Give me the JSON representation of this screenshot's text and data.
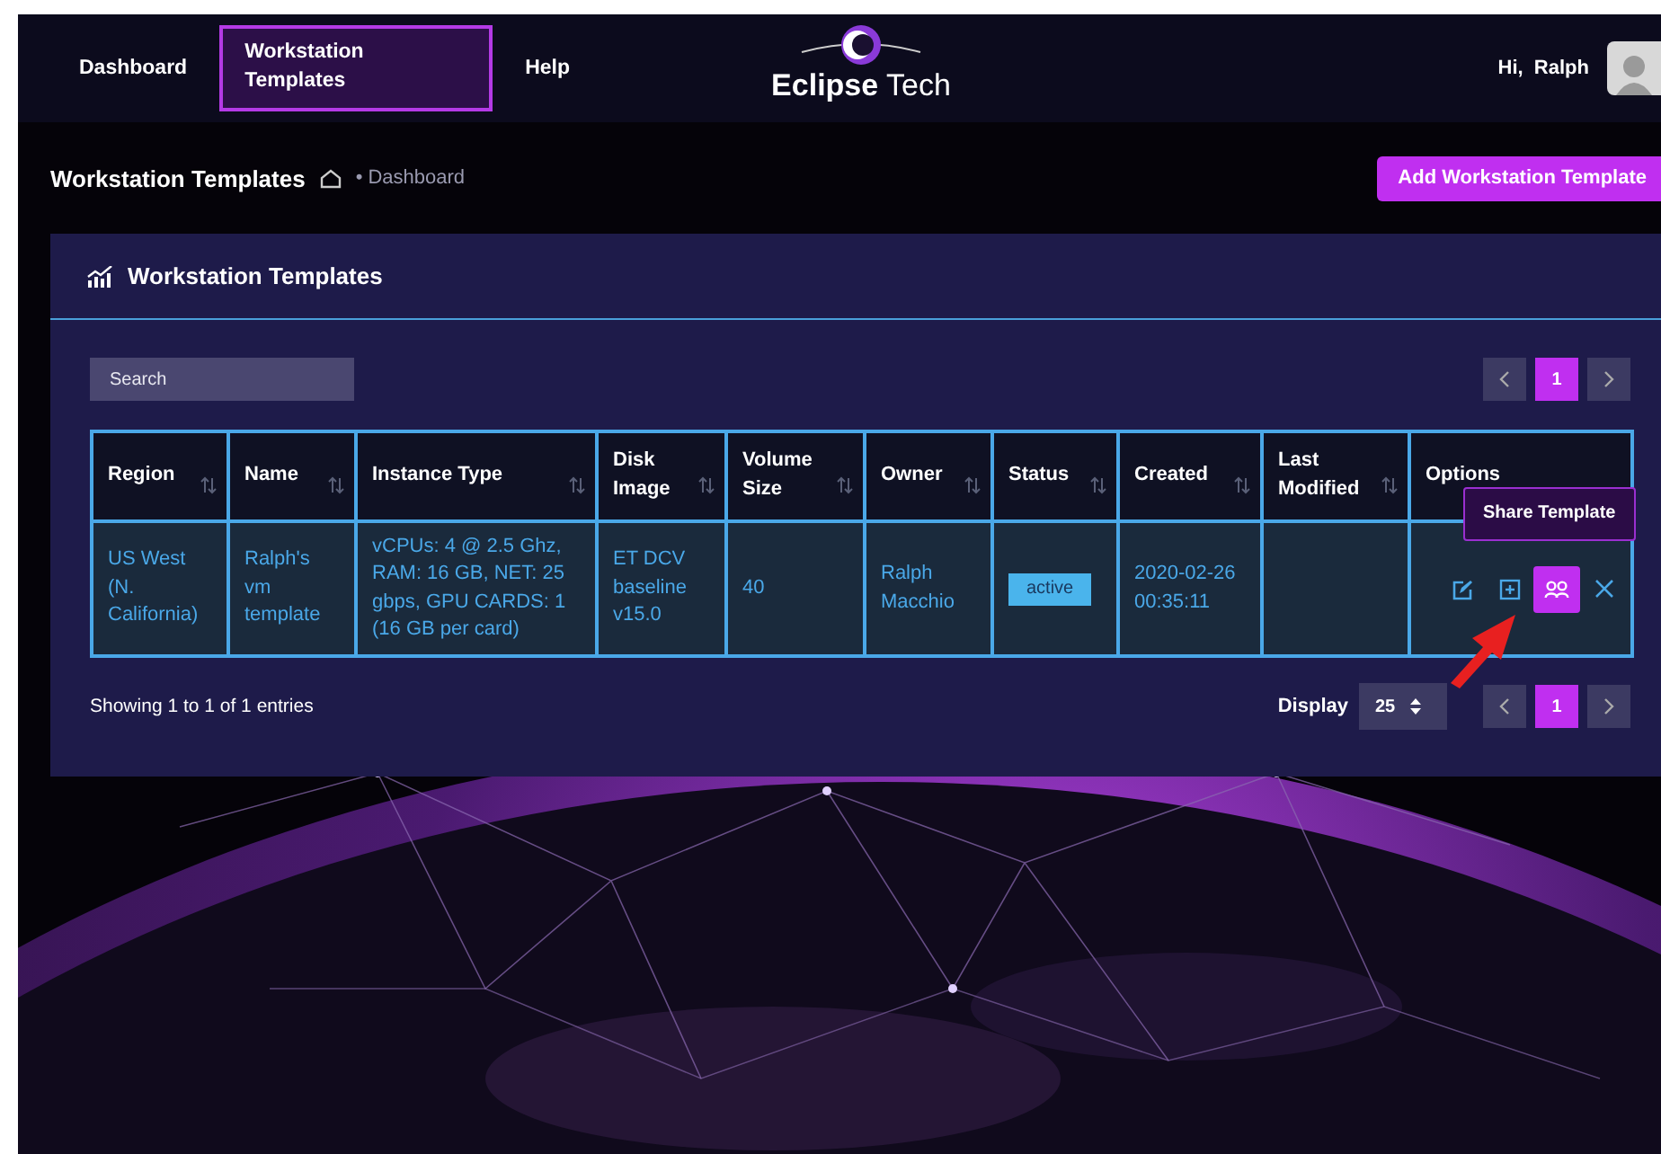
{
  "nav": {
    "items": [
      {
        "label": "Dashboard",
        "selected": false
      },
      {
        "label": "Workstation Templates",
        "selected": true
      },
      {
        "label": "Help",
        "selected": false
      }
    ],
    "logo": {
      "strong": "Eclipse",
      "light": "Tech"
    },
    "greeting": "Hi,  Ralph"
  },
  "header": {
    "title": "Workstation Templates",
    "breadcrumb": "• Dashboard",
    "add_button": "Add Workstation Template"
  },
  "panel": {
    "title": "Workstation Templates",
    "search": {
      "placeholder": "Search"
    },
    "pagination_top": {
      "pages": [
        {
          "label": "1",
          "selected": true
        }
      ]
    },
    "table": {
      "columns": [
        {
          "label": "Region",
          "sortable": true
        },
        {
          "label": "Name",
          "sortable": true
        },
        {
          "label": "Instance Type",
          "sortable": true
        },
        {
          "label": "Disk Image",
          "sortable": true
        },
        {
          "label": "Volume Size",
          "sortable": true
        },
        {
          "label": "Owner",
          "sortable": true
        },
        {
          "label": "Status",
          "sortable": true
        },
        {
          "label": "Created",
          "sortable": true
        },
        {
          "label": "Last Modified",
          "sortable": true
        },
        {
          "label": "Options",
          "sortable": false
        }
      ],
      "rows": [
        {
          "region": "US West (N. California)",
          "name": "Ralph's vm template",
          "instance_type": "vCPUs: 4 @ 2.5 Ghz, RAM: 16 GB, NET: 25 gbps, GPU CARDS: 1 (16 GB per card)",
          "disk_image": "ET DCV baseline v15.0",
          "volume_size": "40",
          "owner": "Ralph Macchio",
          "status": "active",
          "created": "2020-02-26 00:35:11",
          "options": [
            {
              "kind": "edit",
              "highlighted": false
            },
            {
              "kind": "add",
              "highlighted": false
            },
            {
              "kind": "share",
              "highlighted": true,
              "tooltip": "Share Template"
            },
            {
              "kind": "delete",
              "highlighted": false
            }
          ]
        }
      ]
    },
    "footer": {
      "summary": "Showing 1 to 1 of 1 entries",
      "display_label": "Display",
      "display_value": "25"
    },
    "pagination_bottom": {
      "pages": [
        {
          "label": "1",
          "selected": true
        }
      ]
    }
  }
}
